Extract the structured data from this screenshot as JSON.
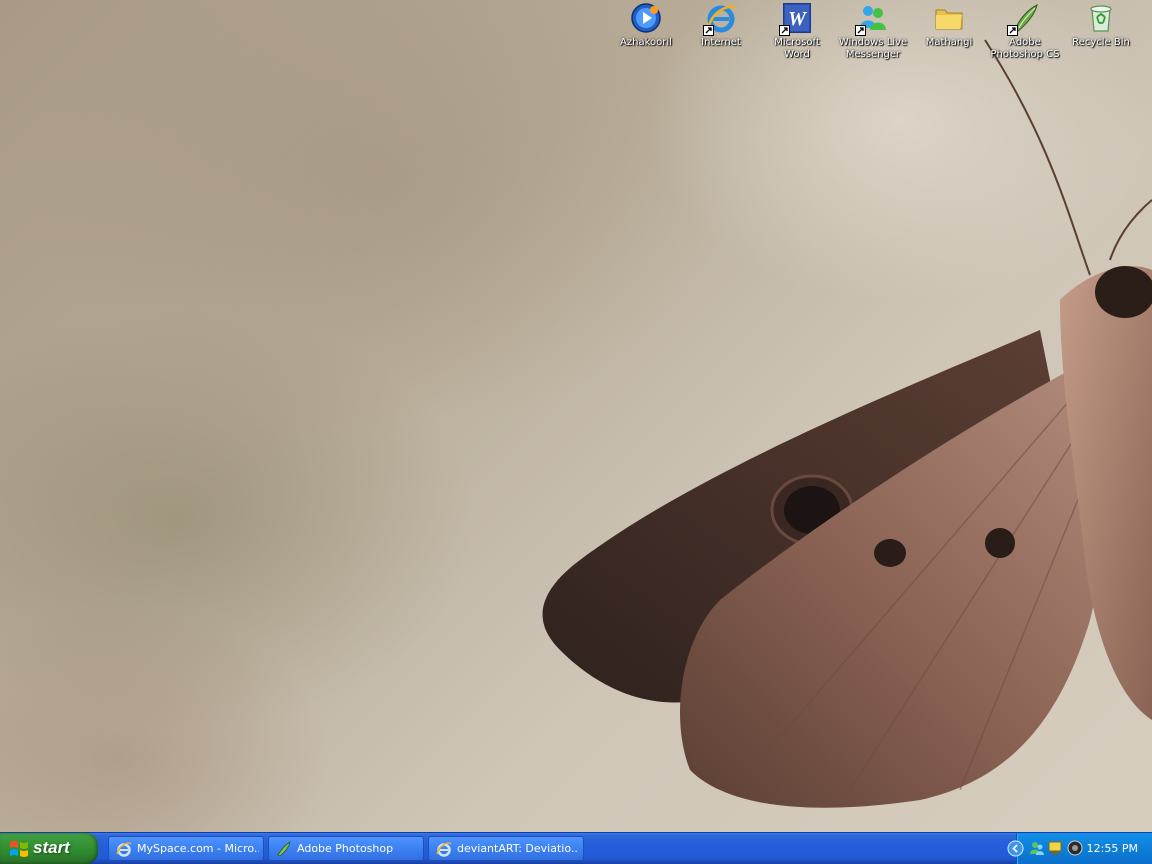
{
  "desktop": {
    "icons": [
      {
        "label": "Azhakooril",
        "icon": "media-player-icon"
      },
      {
        "label": "Internet",
        "icon": "internet-explorer-icon"
      },
      {
        "label": "Microsoft Word",
        "icon": "word-icon"
      },
      {
        "label": "Windows Live Messenger",
        "icon": "messenger-icon"
      },
      {
        "label": "Mathangi",
        "icon": "folder-icon"
      },
      {
        "label": "Adobe Photoshop CS",
        "icon": "photoshop-icon"
      },
      {
        "label": "Recycle Bin",
        "icon": "recycle-bin-icon"
      }
    ],
    "wallpaper": "moth-on-parchment"
  },
  "taskbar": {
    "start_label": "start",
    "tasks": [
      {
        "label": "MySpace.com - Micro...",
        "icon": "internet-explorer-icon"
      },
      {
        "label": "Adobe Photoshop",
        "icon": "photoshop-icon"
      },
      {
        "label": "deviantART: Deviatio...",
        "icon": "internet-explorer-icon"
      }
    ],
    "tray": {
      "clock": "12:55 PM",
      "icons": [
        "chevron-left-icon",
        "network-users-icon",
        "display-icon",
        "audio-icon"
      ]
    },
    "colors": {
      "start_green": "#3c9b3c",
      "bar_blue": "#245edb",
      "tray_blue": "#0e82dc"
    }
  }
}
